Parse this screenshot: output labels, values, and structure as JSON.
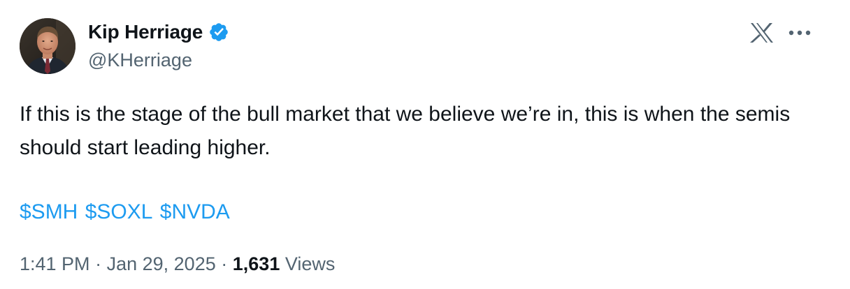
{
  "author": {
    "display_name": "Kip Herriage",
    "handle": "@KHerriage",
    "avatar_icon": "profile-photo",
    "verified_icon": "verified-badge-icon",
    "verified_color": "#1d9bf0"
  },
  "header": {
    "logo_icon": "x-logo-icon",
    "more_icon": "more-options-icon"
  },
  "tweet": {
    "text": "If this is the stage of the bull market that we believe we’re in, this is when the semis should start leading higher.",
    "cashtags": [
      "$SMH",
      "$SOXL",
      "$NVDA"
    ],
    "link_color": "#1d9bf0"
  },
  "meta": {
    "time": "1:41 PM",
    "separator": "·",
    "date": "Jan 29, 2025",
    "views_count": "1,631",
    "views_label": "Views"
  }
}
